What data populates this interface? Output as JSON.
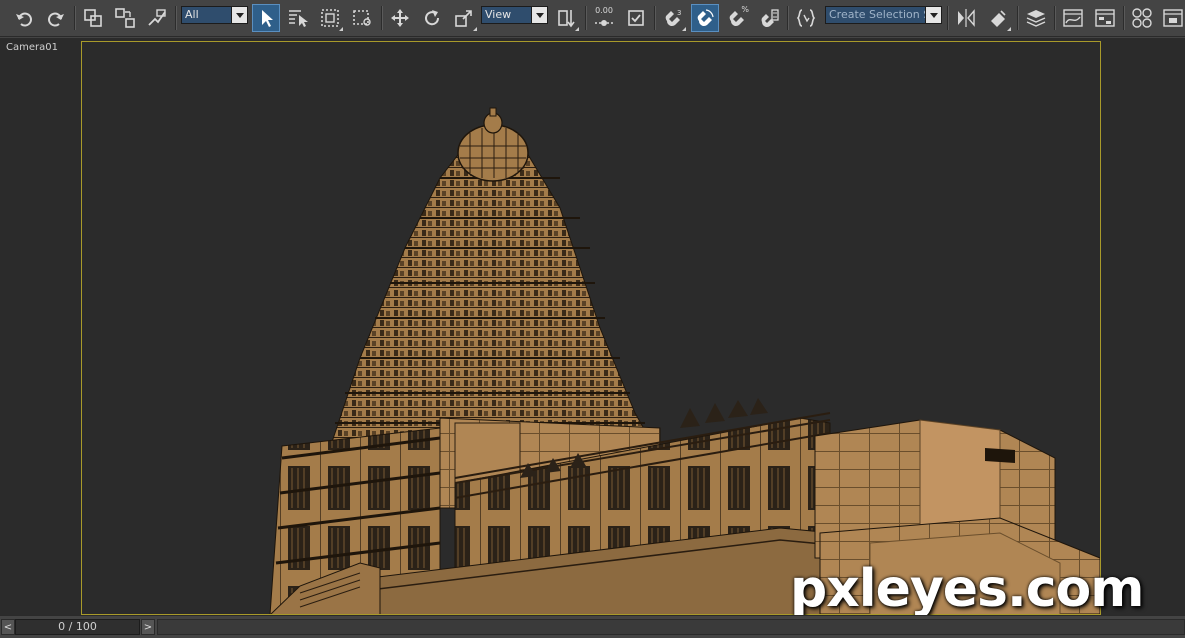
{
  "toolbar": {
    "selection_filter": "All",
    "reference_coord_system": "View",
    "spinner_snap_value": "0.00",
    "percent_snap_label": "%",
    "named_selection_placeholder": "Create Selection Set"
  },
  "viewport": {
    "label": "Camera01",
    "safe_frame_color": "#a89a2a",
    "background_color": "#2b2b2b",
    "model_color": "#a47c4a"
  },
  "watermark": "pxleyes.com",
  "timeslider": {
    "position_text": "0 / 100",
    "prev_glyph": "<",
    "next_glyph": ">"
  },
  "colors": {
    "ui_gray": "#444444",
    "active_button": "#2f5f8a",
    "combo_field": "#2f4d6d"
  }
}
